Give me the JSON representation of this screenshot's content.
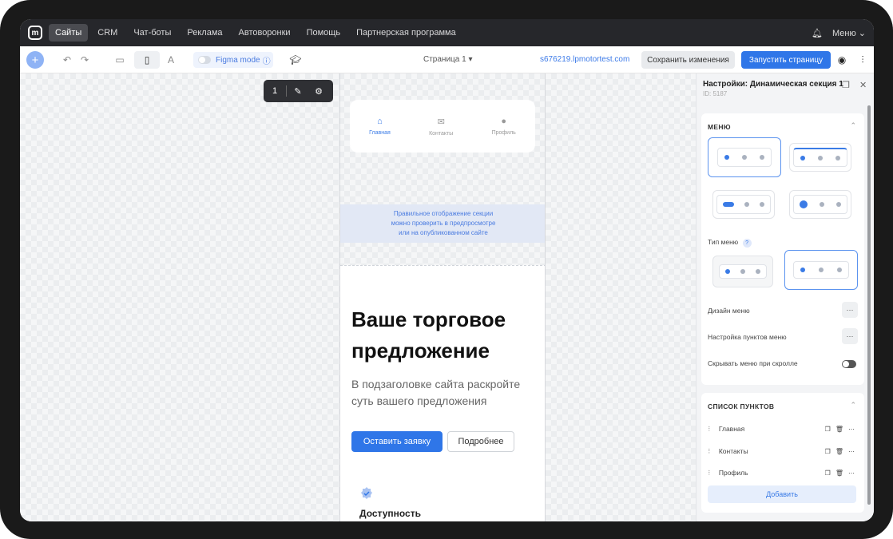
{
  "topnav": {
    "items": [
      "Сайты",
      "CRM",
      "Чат-боты",
      "Реклама",
      "Автоворонки",
      "Помощь",
      "Партнерская программа"
    ],
    "menu_label": "Меню"
  },
  "toolbar": {
    "figma_label": "Figma mode",
    "page_label": "Страница 1",
    "site_url": "s676219.lpmotortest.com",
    "save_label": "Сохранить изменения",
    "launch_label": "Запустить страницу"
  },
  "floatbar": {
    "number": "1"
  },
  "preview": {
    "menu_items": [
      "Главная",
      "Контакты",
      "Профиль"
    ],
    "notice": [
      "Правильное отображение секции",
      "можно проверить в предпросмотре",
      "или на опубликованном сайте"
    ],
    "heading": "Ваше торговое предложение",
    "subheading": "В подзаголовке сайта раскройте суть вашего предложения",
    "primary_button": "Оставить заявку",
    "secondary_button": "Подробнее",
    "feature_title": "Доступность"
  },
  "panel": {
    "title": "Настройки: Динамическая секция 1",
    "id": "ID: 5187",
    "menu_section": "МЕНЮ",
    "menu_type_label": "Тип меню",
    "design_label": "Дизайн меню",
    "items_setup_label": "Настройка пунктов меню",
    "hide_label": "Скрывать меню при скролле",
    "list_section": "СПИСОК ПУНКТОВ",
    "list_items": [
      "Главная",
      "Контакты",
      "Профиль"
    ],
    "add_label": "Добавить"
  },
  "colors": {
    "accent": "#2f76e8",
    "topbar": "#26272b"
  }
}
